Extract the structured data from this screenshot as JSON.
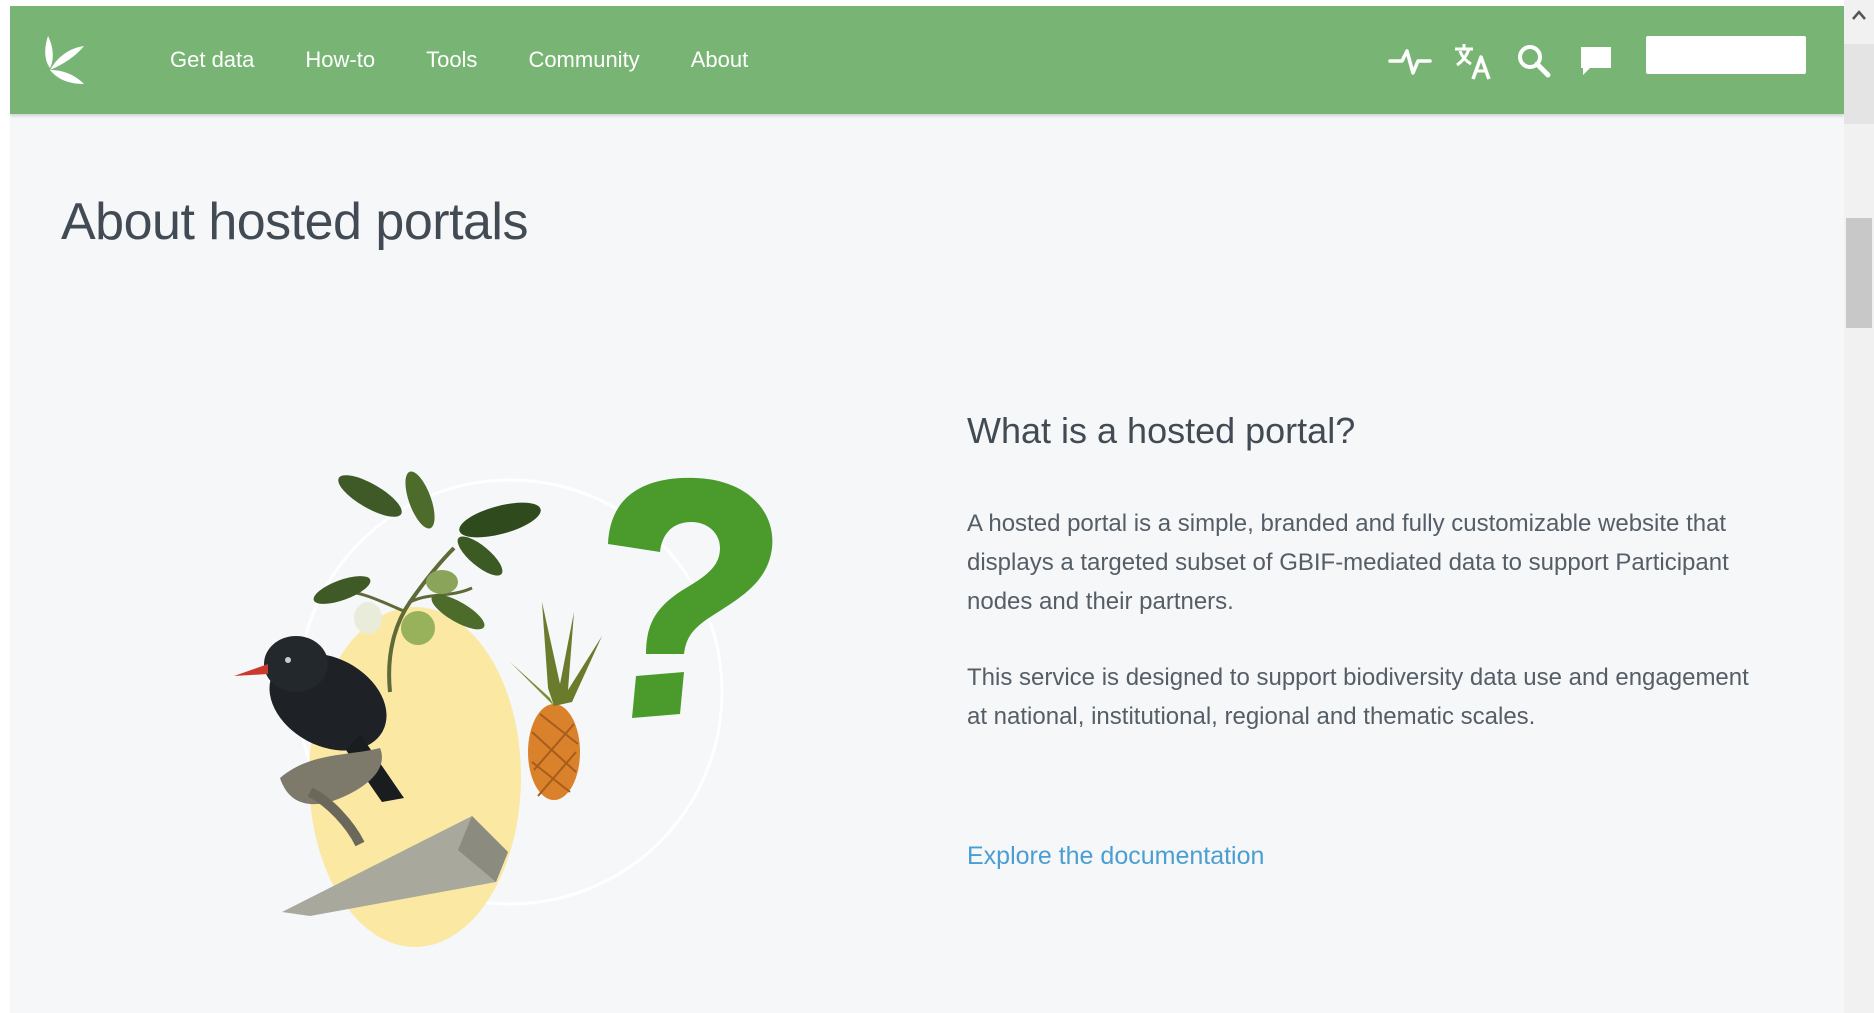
{
  "nav": {
    "logo_icon": "gbif-leaf-logo-icon",
    "links": [
      "Get data",
      "How-to",
      "Tools",
      "Community",
      "About"
    ],
    "icons": [
      "pulse-icon",
      "translate-icon",
      "search-icon",
      "feedback-icon"
    ]
  },
  "page": {
    "title": "About hosted portals",
    "section_title": "What is a hosted portal?",
    "paragraph_1": "A hosted portal is a simple, branded and fully customizable website that displays a targeted subset of GBIF-mediated data to support Participant nodes and their partners.",
    "paragraph_2": "This service is designed to support biodiversity data use and engagement at national, institutional, regional and thematic scales.",
    "link": "Explore the documentation"
  },
  "colors": {
    "navbar": "#78b575",
    "background": "#f5f7f9",
    "title_text": "#424b54",
    "body_text": "#555e66",
    "link": "#4a9ed2",
    "question_mark": "#4a9a2c"
  }
}
